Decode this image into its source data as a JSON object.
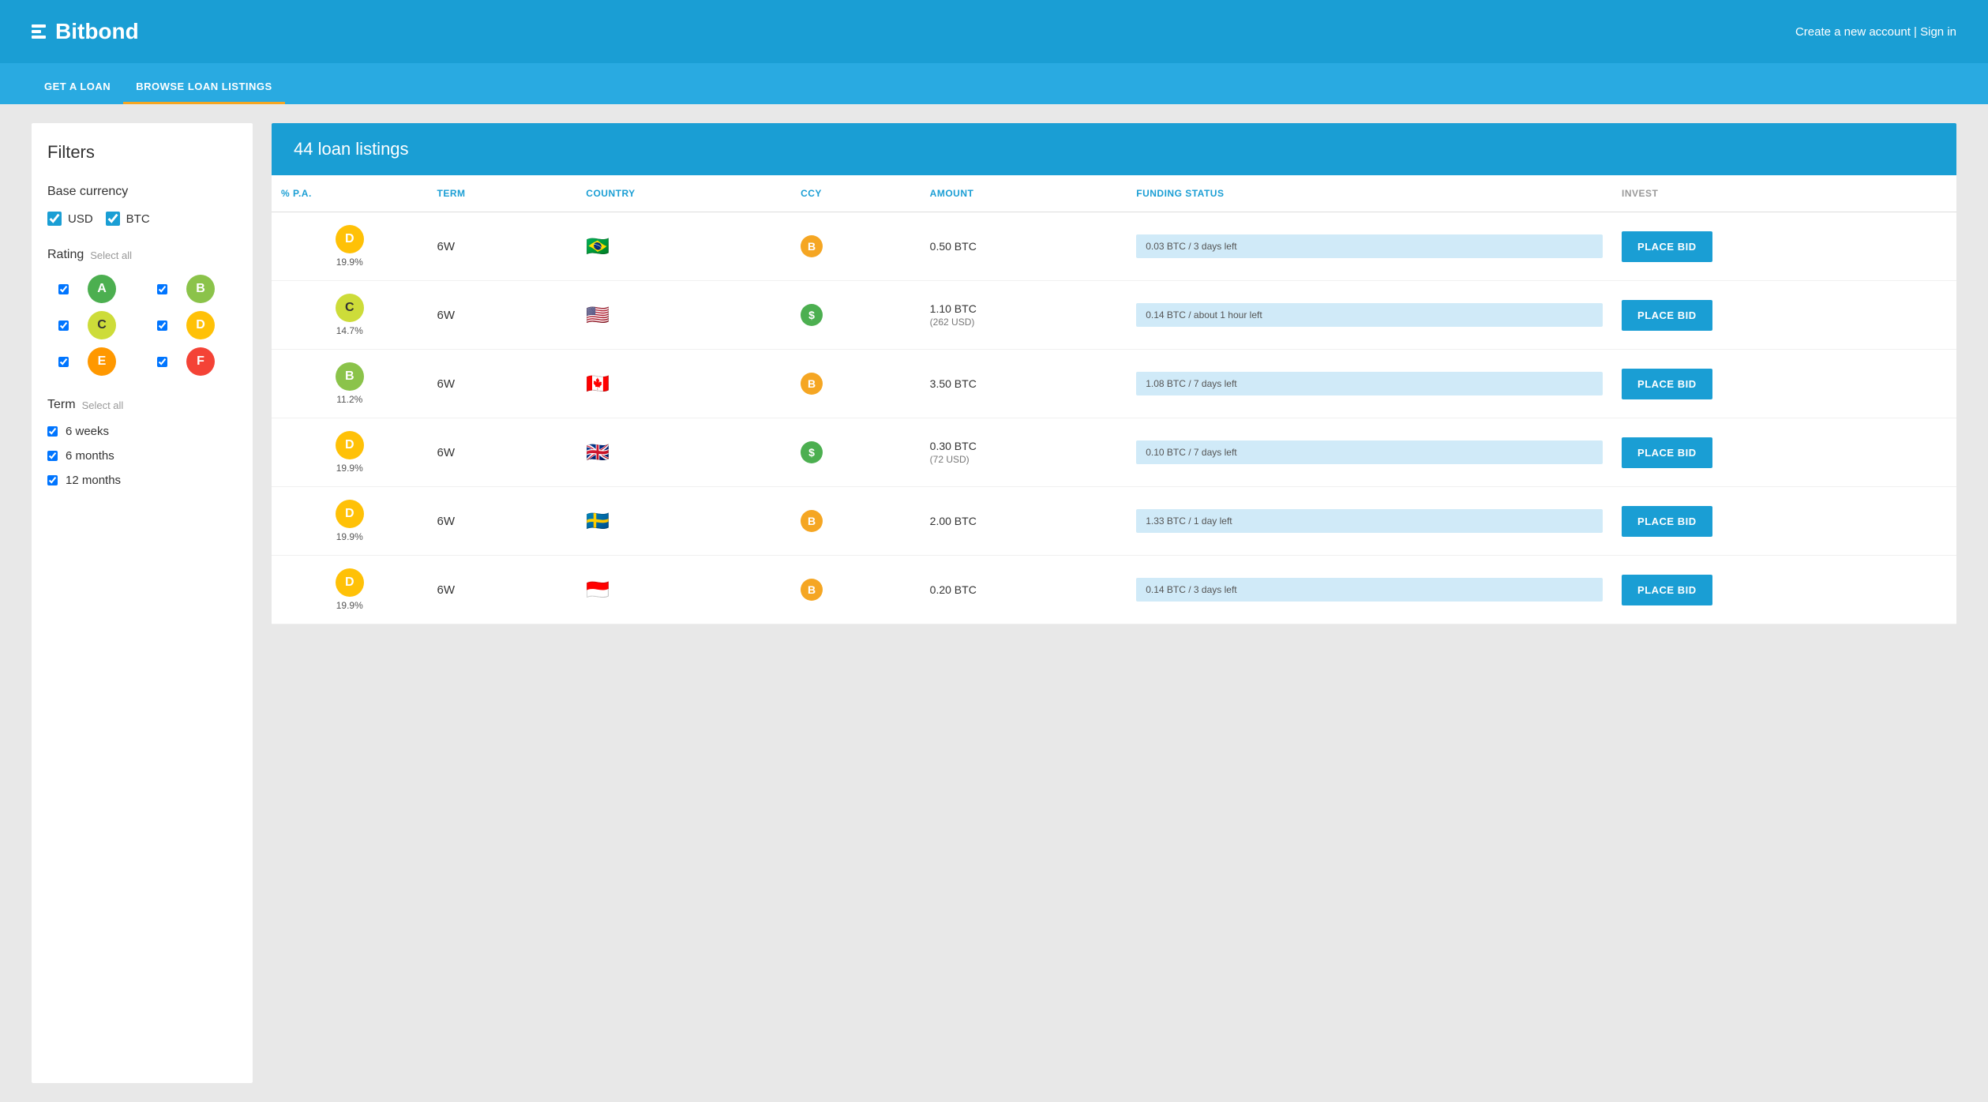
{
  "header": {
    "logo_text": "Bitbond",
    "links": "Create a new account | Sign in",
    "create_account": "Create a new account",
    "sign_in": "Sign in"
  },
  "nav": {
    "items": [
      {
        "label": "GET A LOAN",
        "active": false
      },
      {
        "label": "BROWSE LOAN LISTINGS",
        "active": true
      }
    ]
  },
  "filters": {
    "title": "Filters",
    "base_currency": {
      "label": "Base currency",
      "options": [
        {
          "label": "USD",
          "checked": true
        },
        {
          "label": "BTC",
          "checked": true
        }
      ]
    },
    "rating": {
      "label": "Rating",
      "select_all": "Select all",
      "options": [
        {
          "letter": "A",
          "class": "badge-a",
          "checked": true
        },
        {
          "letter": "B",
          "class": "badge-b",
          "checked": true
        },
        {
          "letter": "C",
          "class": "badge-c",
          "checked": true
        },
        {
          "letter": "D",
          "class": "badge-d",
          "checked": true
        },
        {
          "letter": "E",
          "class": "badge-e",
          "checked": true
        },
        {
          "letter": "F",
          "class": "badge-f",
          "checked": true
        }
      ]
    },
    "term": {
      "label": "Term",
      "select_all": "Select all",
      "options": [
        {
          "label": "6 weeks",
          "checked": true
        },
        {
          "label": "6 months",
          "checked": true
        },
        {
          "label": "12 months",
          "checked": true
        }
      ]
    }
  },
  "listings": {
    "title": "44 loan listings",
    "columns": [
      {
        "label": "% P.A.",
        "color": "blue"
      },
      {
        "label": "TERM",
        "color": "blue"
      },
      {
        "label": "COUNTRY",
        "color": "blue"
      },
      {
        "label": "CCY",
        "color": "blue"
      },
      {
        "label": "AMOUNT",
        "color": "blue"
      },
      {
        "label": "FUNDING STATUS",
        "color": "blue"
      },
      {
        "label": "INVEST",
        "color": "gray"
      }
    ],
    "rows": [
      {
        "rating": "D",
        "rating_class": "badge-d",
        "pct": "19.9%",
        "term": "6W",
        "country_flag": "🇧🇷",
        "ccy": "B",
        "ccy_class": "ccy-btc",
        "amount": "0.50 BTC",
        "amount2": "",
        "funding": "0.03 BTC / 3 days left",
        "btn": "PLACE BID"
      },
      {
        "rating": "C",
        "rating_class": "badge-c",
        "pct": "14.7%",
        "term": "6W",
        "country_flag": "🇺🇸",
        "ccy": "$",
        "ccy_class": "ccy-usd",
        "amount": "1.10 BTC",
        "amount2": "(262 USD)",
        "funding": "0.14 BTC / about 1 hour left",
        "btn": "PLACE BID"
      },
      {
        "rating": "B",
        "rating_class": "badge-b",
        "pct": "11.2%",
        "term": "6W",
        "country_flag": "🇨🇦",
        "ccy": "B",
        "ccy_class": "ccy-btc",
        "amount": "3.50 BTC",
        "amount2": "",
        "funding": "1.08 BTC / 7 days left",
        "btn": "PLACE BID"
      },
      {
        "rating": "D",
        "rating_class": "badge-d",
        "pct": "19.9%",
        "term": "6W",
        "country_flag": "🇬🇧",
        "ccy": "$",
        "ccy_class": "ccy-usd",
        "amount": "0.30 BTC",
        "amount2": "(72 USD)",
        "funding": "0.10 BTC / 7 days left",
        "btn": "PLACE BID"
      },
      {
        "rating": "D",
        "rating_class": "badge-d",
        "pct": "19.9%",
        "term": "6W",
        "country_flag": "🇸🇪",
        "ccy": "B",
        "ccy_class": "ccy-btc",
        "amount": "2.00 BTC",
        "amount2": "",
        "funding": "1.33 BTC / 1 day left",
        "btn": "PLACE BID"
      },
      {
        "rating": "D",
        "rating_class": "badge-d",
        "pct": "19.9%",
        "term": "6W",
        "country_flag": "🇮🇩",
        "ccy": "B",
        "ccy_class": "ccy-btc",
        "amount": "0.20 BTC",
        "amount2": "",
        "funding": "0.14 BTC / 3 days left",
        "btn": "PLACE BID"
      }
    ]
  }
}
